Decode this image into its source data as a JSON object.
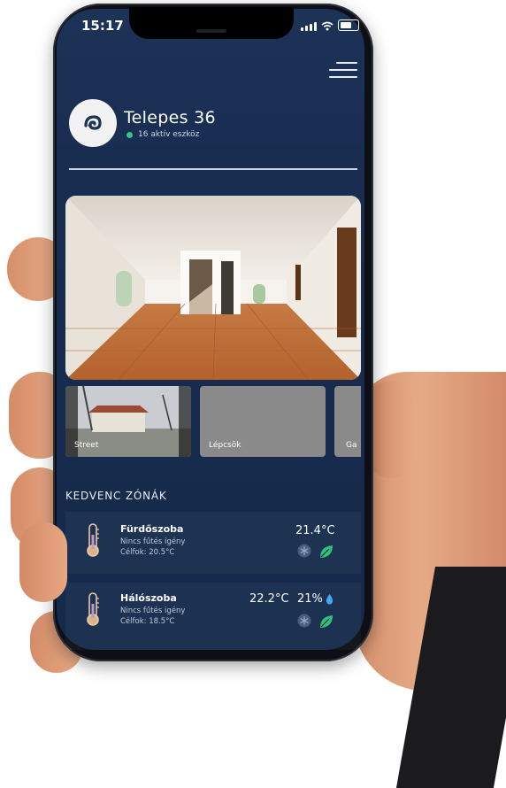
{
  "status_bar": {
    "time": "15:17"
  },
  "home": {
    "name": "Telepes 36",
    "status": "16 aktív eszköz",
    "status_color": "#35c48a"
  },
  "cameras": [
    {
      "label": "Street"
    },
    {
      "label": "Lépcsök"
    },
    {
      "label": "Ga"
    }
  ],
  "favorites": {
    "heading": "KEDVENC ZÓNÁK",
    "zones": [
      {
        "name": "Fürdőszoba",
        "status": "Nincs fűtés igény",
        "target": "Célfok: 20.5°C",
        "temperature": "21.4°C",
        "humidity": ""
      },
      {
        "name": "Hálószoba",
        "status": "Nincs fűtés igény",
        "target": "Célfok: 18.5°C",
        "temperature": "22.2°C",
        "humidity": "21%"
      }
    ]
  },
  "colors": {
    "background": "#172c4f",
    "leaf": "#2ec27e",
    "drop": "#3fa9f5"
  },
  "icons": [
    "menu-icon",
    "chameleon-logo-icon",
    "thermometer-icon",
    "snowflake-icon",
    "leaf-icon",
    "water-drop-icon"
  ]
}
